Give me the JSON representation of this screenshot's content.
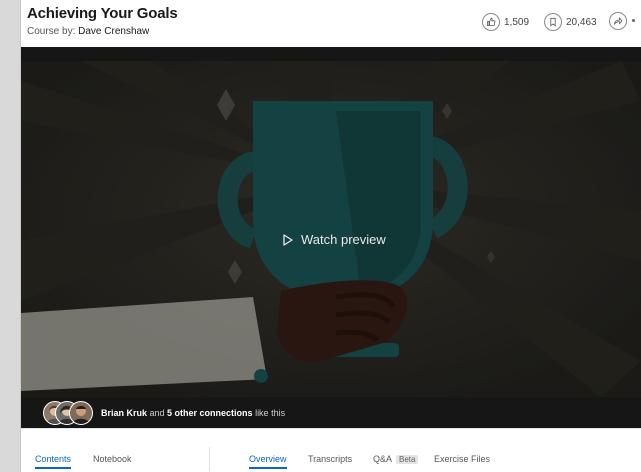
{
  "header": {
    "title": "Achieving Your Goals",
    "author_prefix": "Course by: ",
    "author_name": "Dave Crenshaw",
    "likes_count": "1,509",
    "saves_count": "20,463"
  },
  "video": {
    "preview_label": "Watch preview",
    "play_icon": "play-triangle-icon",
    "likes_bar": {
      "name": "Brian Kruk",
      "middle": " and ",
      "connections": "5 other connections",
      "suffix": " like this"
    }
  },
  "tabs": {
    "left": [
      "Contents",
      "Notebook"
    ],
    "right": [
      "Overview",
      "Transcripts",
      "Q&A",
      "Exercise Files"
    ],
    "beta": "Beta",
    "active_left": "Contents",
    "active_right": "Overview"
  },
  "colors": {
    "accent": "#0a66c2",
    "trophy": "#1d5a5a",
    "video_bg": "#161616"
  },
  "icons": [
    "thumbs-up-icon",
    "bookmark-icon",
    "share-arrow-icon",
    "play-triangle-icon"
  ]
}
